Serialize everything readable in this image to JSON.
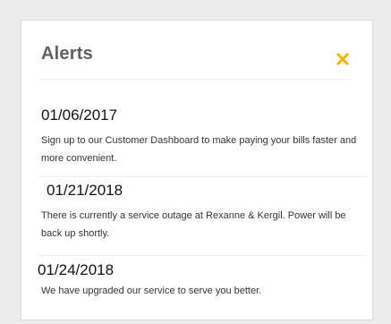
{
  "alerts_panel": {
    "title": "Alerts",
    "accent_color": "#f5b400",
    "close_icon": "close-icon",
    "items": [
      {
        "date": "01/06/2017",
        "message": "Sign up to our Customer Dashboard to make paying your bills faster and more convenient."
      },
      {
        "date": "01/21/2018",
        "message": "There is currently a service outage at Rexanne & Kergil. Power will be back up shortly."
      },
      {
        "date": "01/24/2018",
        "message": "We have upgraded our service to serve you better."
      }
    ]
  }
}
